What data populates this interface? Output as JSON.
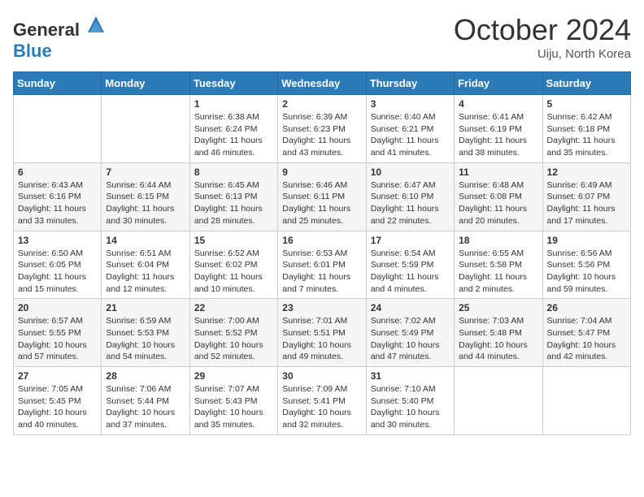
{
  "header": {
    "logo_general": "General",
    "logo_blue": "Blue",
    "month_title": "October 2024",
    "location": "Uiju, North Korea"
  },
  "days_of_week": [
    "Sunday",
    "Monday",
    "Tuesday",
    "Wednesday",
    "Thursday",
    "Friday",
    "Saturday"
  ],
  "weeks": [
    [
      {
        "day": "",
        "sunrise": "",
        "sunset": "",
        "daylight": ""
      },
      {
        "day": "",
        "sunrise": "",
        "sunset": "",
        "daylight": ""
      },
      {
        "day": "1",
        "sunrise": "Sunrise: 6:38 AM",
        "sunset": "Sunset: 6:24 PM",
        "daylight": "Daylight: 11 hours and 46 minutes."
      },
      {
        "day": "2",
        "sunrise": "Sunrise: 6:39 AM",
        "sunset": "Sunset: 6:23 PM",
        "daylight": "Daylight: 11 hours and 43 minutes."
      },
      {
        "day": "3",
        "sunrise": "Sunrise: 6:40 AM",
        "sunset": "Sunset: 6:21 PM",
        "daylight": "Daylight: 11 hours and 41 minutes."
      },
      {
        "day": "4",
        "sunrise": "Sunrise: 6:41 AM",
        "sunset": "Sunset: 6:19 PM",
        "daylight": "Daylight: 11 hours and 38 minutes."
      },
      {
        "day": "5",
        "sunrise": "Sunrise: 6:42 AM",
        "sunset": "Sunset: 6:18 PM",
        "daylight": "Daylight: 11 hours and 35 minutes."
      }
    ],
    [
      {
        "day": "6",
        "sunrise": "Sunrise: 6:43 AM",
        "sunset": "Sunset: 6:16 PM",
        "daylight": "Daylight: 11 hours and 33 minutes."
      },
      {
        "day": "7",
        "sunrise": "Sunrise: 6:44 AM",
        "sunset": "Sunset: 6:15 PM",
        "daylight": "Daylight: 11 hours and 30 minutes."
      },
      {
        "day": "8",
        "sunrise": "Sunrise: 6:45 AM",
        "sunset": "Sunset: 6:13 PM",
        "daylight": "Daylight: 11 hours and 28 minutes."
      },
      {
        "day": "9",
        "sunrise": "Sunrise: 6:46 AM",
        "sunset": "Sunset: 6:11 PM",
        "daylight": "Daylight: 11 hours and 25 minutes."
      },
      {
        "day": "10",
        "sunrise": "Sunrise: 6:47 AM",
        "sunset": "Sunset: 6:10 PM",
        "daylight": "Daylight: 11 hours and 22 minutes."
      },
      {
        "day": "11",
        "sunrise": "Sunrise: 6:48 AM",
        "sunset": "Sunset: 6:08 PM",
        "daylight": "Daylight: 11 hours and 20 minutes."
      },
      {
        "day": "12",
        "sunrise": "Sunrise: 6:49 AM",
        "sunset": "Sunset: 6:07 PM",
        "daylight": "Daylight: 11 hours and 17 minutes."
      }
    ],
    [
      {
        "day": "13",
        "sunrise": "Sunrise: 6:50 AM",
        "sunset": "Sunset: 6:05 PM",
        "daylight": "Daylight: 11 hours and 15 minutes."
      },
      {
        "day": "14",
        "sunrise": "Sunrise: 6:51 AM",
        "sunset": "Sunset: 6:04 PM",
        "daylight": "Daylight: 11 hours and 12 minutes."
      },
      {
        "day": "15",
        "sunrise": "Sunrise: 6:52 AM",
        "sunset": "Sunset: 6:02 PM",
        "daylight": "Daylight: 11 hours and 10 minutes."
      },
      {
        "day": "16",
        "sunrise": "Sunrise: 6:53 AM",
        "sunset": "Sunset: 6:01 PM",
        "daylight": "Daylight: 11 hours and 7 minutes."
      },
      {
        "day": "17",
        "sunrise": "Sunrise: 6:54 AM",
        "sunset": "Sunset: 5:59 PM",
        "daylight": "Daylight: 11 hours and 4 minutes."
      },
      {
        "day": "18",
        "sunrise": "Sunrise: 6:55 AM",
        "sunset": "Sunset: 5:58 PM",
        "daylight": "Daylight: 11 hours and 2 minutes."
      },
      {
        "day": "19",
        "sunrise": "Sunrise: 6:56 AM",
        "sunset": "Sunset: 5:56 PM",
        "daylight": "Daylight: 10 hours and 59 minutes."
      }
    ],
    [
      {
        "day": "20",
        "sunrise": "Sunrise: 6:57 AM",
        "sunset": "Sunset: 5:55 PM",
        "daylight": "Daylight: 10 hours and 57 minutes."
      },
      {
        "day": "21",
        "sunrise": "Sunrise: 6:59 AM",
        "sunset": "Sunset: 5:53 PM",
        "daylight": "Daylight: 10 hours and 54 minutes."
      },
      {
        "day": "22",
        "sunrise": "Sunrise: 7:00 AM",
        "sunset": "Sunset: 5:52 PM",
        "daylight": "Daylight: 10 hours and 52 minutes."
      },
      {
        "day": "23",
        "sunrise": "Sunrise: 7:01 AM",
        "sunset": "Sunset: 5:51 PM",
        "daylight": "Daylight: 10 hours and 49 minutes."
      },
      {
        "day": "24",
        "sunrise": "Sunrise: 7:02 AM",
        "sunset": "Sunset: 5:49 PM",
        "daylight": "Daylight: 10 hours and 47 minutes."
      },
      {
        "day": "25",
        "sunrise": "Sunrise: 7:03 AM",
        "sunset": "Sunset: 5:48 PM",
        "daylight": "Daylight: 10 hours and 44 minutes."
      },
      {
        "day": "26",
        "sunrise": "Sunrise: 7:04 AM",
        "sunset": "Sunset: 5:47 PM",
        "daylight": "Daylight: 10 hours and 42 minutes."
      }
    ],
    [
      {
        "day": "27",
        "sunrise": "Sunrise: 7:05 AM",
        "sunset": "Sunset: 5:45 PM",
        "daylight": "Daylight: 10 hours and 40 minutes."
      },
      {
        "day": "28",
        "sunrise": "Sunrise: 7:06 AM",
        "sunset": "Sunset: 5:44 PM",
        "daylight": "Daylight: 10 hours and 37 minutes."
      },
      {
        "day": "29",
        "sunrise": "Sunrise: 7:07 AM",
        "sunset": "Sunset: 5:43 PM",
        "daylight": "Daylight: 10 hours and 35 minutes."
      },
      {
        "day": "30",
        "sunrise": "Sunrise: 7:09 AM",
        "sunset": "Sunset: 5:41 PM",
        "daylight": "Daylight: 10 hours and 32 minutes."
      },
      {
        "day": "31",
        "sunrise": "Sunrise: 7:10 AM",
        "sunset": "Sunset: 5:40 PM",
        "daylight": "Daylight: 10 hours and 30 minutes."
      },
      {
        "day": "",
        "sunrise": "",
        "sunset": "",
        "daylight": ""
      },
      {
        "day": "",
        "sunrise": "",
        "sunset": "",
        "daylight": ""
      }
    ]
  ]
}
